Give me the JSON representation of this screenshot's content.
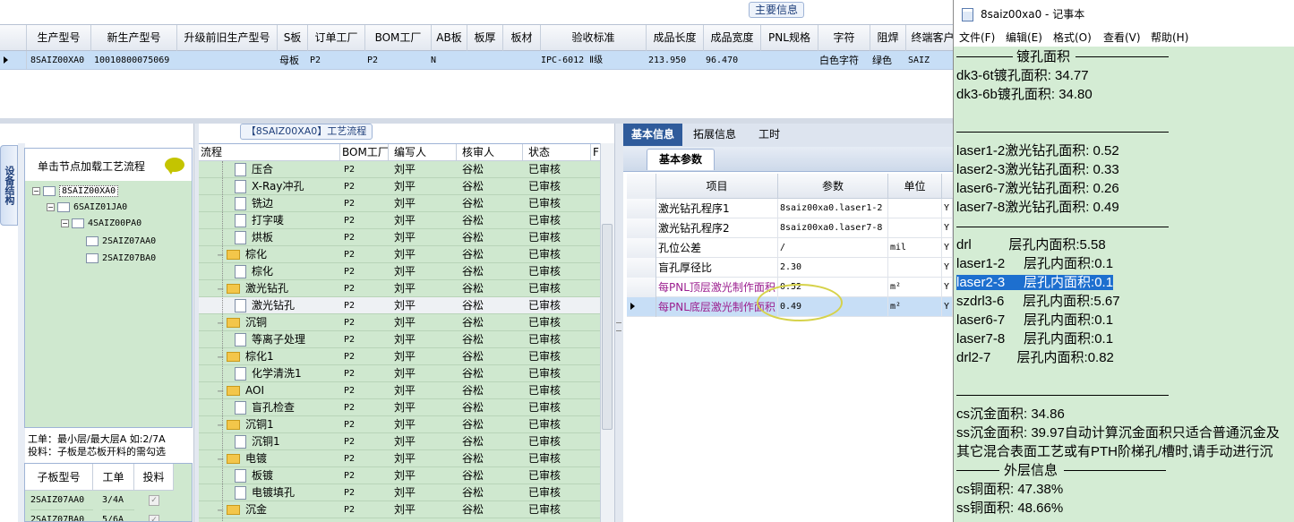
{
  "top": {
    "tab_label": "主要信息",
    "columns": [
      "生产型号",
      "新生产型号",
      "升级前旧生产型号",
      "S板",
      "订单工厂",
      "BOM工厂",
      "AB板",
      "板厚",
      "板材",
      "验收标准",
      "成品长度",
      "成品宽度",
      "PNL规格",
      "字符",
      "阻焊",
      "终端客户"
    ],
    "row": {
      "model": "8SAIZ00XA0",
      "new_model": "10010800075069",
      "s_board": "母板",
      "order_factory": "P2",
      "bom_factory": "P2",
      "ab_board": "N",
      "standard": "IPC-6012 Ⅱ级",
      "length": "213.950",
      "width": "96.470",
      "char": "白色字符",
      "solder_mask": "绿色",
      "client": "SAIZ"
    }
  },
  "left": {
    "vertical_tab": "设备结构",
    "tree_header": "单击节点加载工艺流程",
    "tree": [
      "8SAIZ00XA0",
      "6SAIZ01JA0",
      "4SAIZ00PA0",
      "2SAIZ07AA0",
      "2SAIZ07BA0"
    ],
    "info_line1": "工单：最小层/最大层A 如:2/7A",
    "info_line2": "投料：子板是芯板开料的需勾选",
    "sub_columns": [
      "子板型号",
      "工单",
      "投料"
    ],
    "sub_rows": [
      {
        "model": "2SAIZ07AA0",
        "order": "3/4A"
      },
      {
        "model": "2SAIZ07BA0",
        "order": "5/6A"
      }
    ]
  },
  "process": {
    "title": "【8SAIZ00XA0】工艺流程",
    "columns": [
      "流程",
      "BOM工厂",
      "编写人",
      "核审人",
      "状态",
      "F"
    ],
    "rows": [
      {
        "name": "压合",
        "kind": "doc",
        "bom": "P2",
        "writer": "刘平",
        "checker": "谷松",
        "status": "已审核"
      },
      {
        "name": "X-Ray冲孔",
        "kind": "doc",
        "bom": "P2",
        "writer": "刘平",
        "checker": "谷松",
        "status": "已审核"
      },
      {
        "name": "铣边",
        "kind": "doc",
        "bom": "P2",
        "writer": "刘平",
        "checker": "谷松",
        "status": "已审核"
      },
      {
        "name": "打字唛",
        "kind": "doc",
        "bom": "P2",
        "writer": "刘平",
        "checker": "谷松",
        "status": "已审核"
      },
      {
        "name": "烘板",
        "kind": "doc",
        "bom": "P2",
        "writer": "刘平",
        "checker": "谷松",
        "status": "已审核"
      },
      {
        "name": "棕化",
        "kind": "folder",
        "bom": "P2",
        "writer": "刘平",
        "checker": "谷松",
        "status": "已审核"
      },
      {
        "name": "棕化",
        "kind": "doc",
        "bom": "P2",
        "writer": "刘平",
        "checker": "谷松",
        "status": "已审核"
      },
      {
        "name": "激光钻孔",
        "kind": "folder",
        "bom": "P2",
        "writer": "刘平",
        "checker": "谷松",
        "status": "已审核"
      },
      {
        "name": "激光钻孔",
        "kind": "doc",
        "bom": "P2",
        "writer": "刘平",
        "checker": "谷松",
        "status": "已审核"
      },
      {
        "name": "沉铜",
        "kind": "folder",
        "bom": "P2",
        "writer": "刘平",
        "checker": "谷松",
        "status": "已审核"
      },
      {
        "name": "等离子处理",
        "kind": "doc",
        "bom": "P2",
        "writer": "刘平",
        "checker": "谷松",
        "status": "已审核"
      },
      {
        "name": "棕化1",
        "kind": "folder",
        "bom": "P2",
        "writer": "刘平",
        "checker": "谷松",
        "status": "已审核"
      },
      {
        "name": "化学清洗1",
        "kind": "doc",
        "bom": "P2",
        "writer": "刘平",
        "checker": "谷松",
        "status": "已审核"
      },
      {
        "name": "AOI",
        "kind": "folder",
        "bom": "P2",
        "writer": "刘平",
        "checker": "谷松",
        "status": "已审核"
      },
      {
        "name": "盲孔检查",
        "kind": "doc",
        "bom": "P2",
        "writer": "刘平",
        "checker": "谷松",
        "status": "已审核"
      },
      {
        "name": "沉铜1",
        "kind": "folder",
        "bom": "P2",
        "writer": "刘平",
        "checker": "谷松",
        "status": "已审核"
      },
      {
        "name": "沉铜1",
        "kind": "doc",
        "bom": "P2",
        "writer": "刘平",
        "checker": "谷松",
        "status": "已审核"
      },
      {
        "name": "电镀",
        "kind": "folder",
        "bom": "P2",
        "writer": "刘平",
        "checker": "谷松",
        "status": "已审核"
      },
      {
        "name": "板镀",
        "kind": "doc",
        "bom": "P2",
        "writer": "刘平",
        "checker": "谷松",
        "status": "已审核"
      },
      {
        "name": "电镀填孔",
        "kind": "doc",
        "bom": "P2",
        "writer": "刘平",
        "checker": "谷松",
        "status": "已审核"
      },
      {
        "name": "沉金",
        "kind": "folder",
        "bom": "P2",
        "writer": "刘平",
        "checker": "谷松",
        "status": "已审核"
      }
    ]
  },
  "info": {
    "tabs": [
      "基本信息",
      "拓展信息",
      "工时"
    ],
    "sub_tab": "基本参数",
    "columns": [
      "项目",
      "参数",
      "单位"
    ],
    "rows": [
      {
        "item": "激光钻孔程序1",
        "param": "8saiz00xa0.laser1-2",
        "unit": "",
        "tail": "Y"
      },
      {
        "item": "激光钻孔程序2",
        "param": "8saiz00xa0.laser7-8",
        "unit": "",
        "tail": "Y"
      },
      {
        "item": "孔位公差",
        "param": "/",
        "unit": "mil",
        "tail": "Y"
      },
      {
        "item": "盲孔厚径比",
        "param": "2.30",
        "unit": "",
        "tail": "Y"
      },
      {
        "item": "每PNL顶层激光制作面积",
        "param": "0.52",
        "unit": "m²",
        "tail": "Y"
      },
      {
        "item": "每PNL底层激光制作面积",
        "param": "0.49",
        "unit": "m²",
        "tail": "Y"
      }
    ]
  },
  "notepad": {
    "title": "8saiz00xa0 - 记事本",
    "menu": [
      "文件(F)",
      "编辑(E)",
      "格式(O)",
      "查看(V)",
      "帮助(H)"
    ],
    "lines": {
      "l0": "镀孔面积",
      "l1": "dk3-6t镀孔面积: 34.77",
      "l2": "dk3-6b镀孔面积: 34.80",
      "l3": "laser1-2激光钻孔面积: 0.52",
      "l4": "laser2-3激光钻孔面积: 0.33",
      "l5": "laser6-7激光钻孔面积: 0.26",
      "l6": "laser7-8激光钻孔面积: 0.49",
      "l7": "drl          层孔内面积:5.58",
      "l8": "laser1-2     层孔内面积:0.1",
      "l9a": "laser2-3",
      "l9b": "     层孔内面积:0.1",
      "l10": "szdrl3-6     层孔内面积:5.67",
      "l11": "laser6-7     层孔内面积:0.1",
      "l12": "laser7-8     层孔内面积:0.1",
      "l13": "drl2-7       层孔内面积:0.82",
      "l14": "cs沉金面积: 34.86",
      "l15": "ss沉金面积: 39.97自动计算沉金面积只适合普通沉金及",
      "l16": "其它混合表面工艺或有PTH阶梯孔/槽时,请手动进行沉",
      "l17": "外层信息",
      "l18": "cs铜面积: 47.38%",
      "l19": "ss铜面积: 48.66%"
    }
  }
}
